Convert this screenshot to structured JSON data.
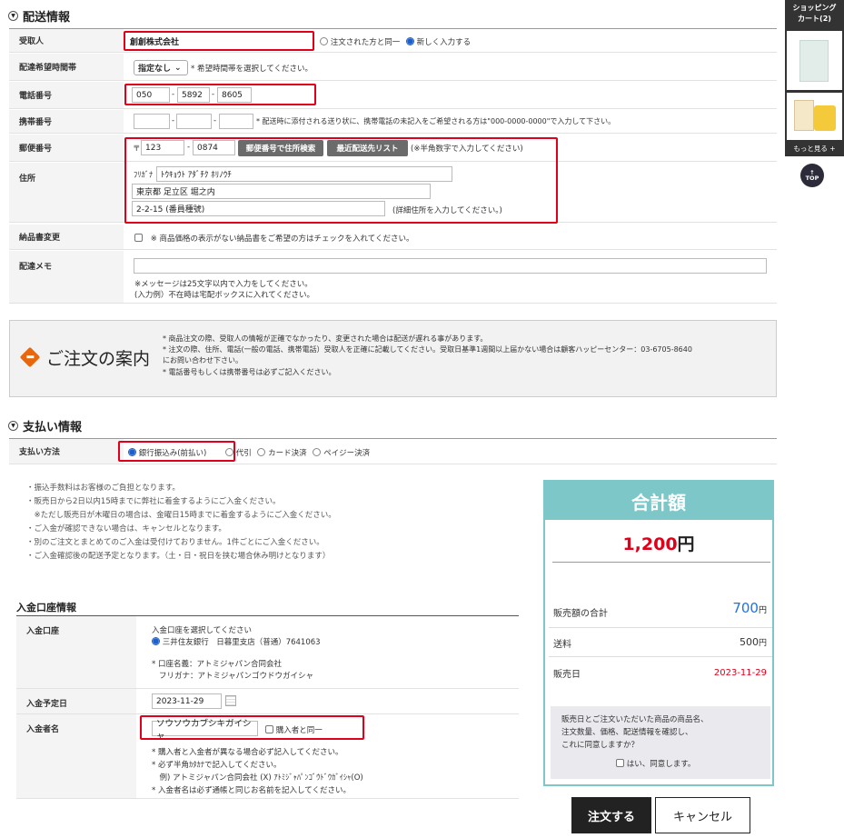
{
  "shipping": {
    "title": "配送情報",
    "recipient": {
      "label": "受取人",
      "value": "創創株式会社",
      "opt_same": "注文された方と同一",
      "opt_new": "新しく入力する"
    },
    "delivery_time": {
      "label": "配達希望時間帯",
      "select": "指定なし",
      "note": "* 希望時間帯を選択してください。"
    },
    "phone": {
      "label": "電話番号",
      "p1": "050",
      "p2": "5892",
      "p3": "8605",
      "dash": "-"
    },
    "mobile": {
      "label": "携帯番号",
      "note": "* 配送時に添付される送り状に、携帯電話の未記入をご希望される方は\"000-0000-0000\"で入力して下さい。"
    },
    "postal": {
      "label": "郵便番号",
      "mark": "〒",
      "z1": "123",
      "z2": "0874",
      "search_btn": "郵便番号で住所検索",
      "recent_btn": "最近配送先リスト",
      "note": "(※半角数字で入力してください)"
    },
    "address": {
      "label": "住所",
      "kana_label": "ﾌﾘｶﾞﾅ",
      "kana": "ﾄｳｷｮｳﾄ ｱﾀﾞﾁｸ ﾎﾘﾉｳﾁ",
      "line1": "東京都 足立区 堀之内",
      "line2": "2-2-15 (番員種號)",
      "note": "(詳細住所を入力してください。)"
    },
    "invoice": {
      "label": "納品書変更",
      "note": "※ 商品価格の表示がない納品書をご希望の方はチェックを入れてください。"
    },
    "memo": {
      "label": "配達メモ",
      "note1": "※メッセージは25文字以内で入力をしてください。",
      "note2": "(入力例）不在時は宅配ボックスに入れてください。"
    }
  },
  "notice": {
    "title": "ご注文の案内",
    "line1": "* 商品注文の際、受取人の情報が正確でなかったり、変更された場合は配送が遅れる事があります。",
    "line2": "* 注文の際、住所、電話(一般の電話、携帯電話）受取人を正確に記載してください。受取日基準1週間以上届かない場合は顧客ハッピーセンター：03-6705-8640",
    "line3": "にお問い合わせ下さい。",
    "line4": "* 電話番号もしくは携帯番号は必ずご記入ください。"
  },
  "payment": {
    "title": "支払い情報",
    "method_label": "支払い方法",
    "opt_bank": "銀行振込み(前払い)",
    "opt_cod": "代引",
    "opt_card": "カード決済",
    "opt_paygy": "ペイジー決済",
    "notes": [
      "・振込手数料はお客様のご負担となります。",
      "・販売日から2日以内15時までに弊社に着金するようにご入金ください。",
      "　※ただし販売日が木曜日の場合は、金曜日15時までに着金するようにご入金ください。",
      "・ご入金が確認できない場合は、キャンセルとなります。",
      "・別のご注文とまとめてのご入金は受付けておりません。1件ごとにご入金ください。",
      "・ご入金確認後の配送予定となります。（土・日・祝日を挟む場合休み明けとなります）"
    ]
  },
  "bank": {
    "title": "入金口座情報",
    "account_label": "入金口座",
    "account_prompt": "入金口座を選択してください",
    "account_option": "三井住友銀行　日暮里支店（普通）7641063",
    "name_line": "* 口座名義：アトミジャパン合同会社",
    "kana_line": "フリガナ：アトミジャパンゴウドウガイシャ",
    "date_label": "入金予定日",
    "date_value": "2023-11-29",
    "payer_label": "入金者名",
    "payer_value": "ソウソウカブシキガイシャ",
    "payer_same": "購入者と同一",
    "payer_notes": [
      "* 購入者と入金者が異なる場合必ず記入してください。",
      "* 必ず半角ｶﾀｶﾅで記入してください。",
      "　例) アトミジャパン合同会社 (X) ｱﾄﾐｼﾞｬﾊﾟﾝｺﾞｳﾄﾞｳｶﾞｲｼｬ(O)",
      "* 入金者名は必ず通帳と同じお名前を記入してください。"
    ]
  },
  "total": {
    "title": "合計額",
    "amount": "1,200",
    "yen": "円",
    "subtotal_label": "販売額の合計",
    "subtotal": "700",
    "shipping_label": "送料",
    "shipping": "500",
    "date_label": "販売日",
    "date": "2023-11-29",
    "agree1": "販売日とご注文いただいた商品の商品名、",
    "agree2": "注文数量、価格、配送情報を確認し、",
    "agree3": "これに同意しますか？",
    "agree_check": "はい、同意します。"
  },
  "actions": {
    "order": "注文する",
    "cancel": "キャンセル"
  },
  "cart": {
    "title1": "ショッピング",
    "title2": "カート(2)",
    "more": "もっと見る +",
    "top": "TOP"
  },
  "colors": {
    "red": "#e0001a",
    "teal": "#7dc7c9",
    "blue": "#1a73e8",
    "orange": "#e8660c"
  }
}
